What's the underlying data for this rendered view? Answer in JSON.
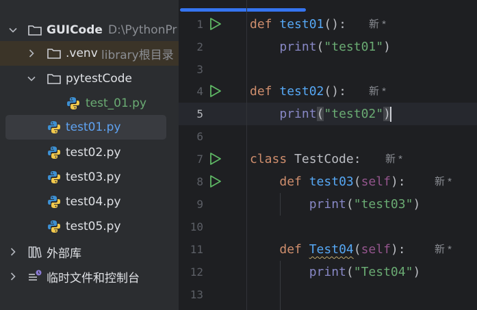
{
  "tree": {
    "root": {
      "label": "GUICode",
      "hint": "D:\\PythonPr"
    },
    "venv": {
      "label": ".venv",
      "hint": "library根目录"
    },
    "pytest_folder": {
      "label": "pytestCode"
    },
    "pytest_file": {
      "label": "test_01.py"
    },
    "files": [
      "test01.py",
      "test02.py",
      "test03.py",
      "test04.py",
      "test05.py"
    ],
    "ext_libs": {
      "label": "外部库"
    },
    "scratches": {
      "label": "临时文件和控制台"
    }
  },
  "editor": {
    "line_numbers": [
      "1",
      "2",
      "3",
      "4",
      "5",
      "6",
      "7",
      "8",
      "9",
      "10",
      "11",
      "12",
      "13"
    ],
    "current_line": "5",
    "badge": "新 *",
    "colors": {
      "keyword": "#cf8e6d",
      "function": "#56a8f5",
      "builtin": "#8888c6",
      "string": "#6aab73",
      "self": "#94558d",
      "run_icon": "#5fb865"
    },
    "lines": {
      "l1": {
        "kw": "def",
        "name": "test01",
        "tail": "():"
      },
      "l2": {
        "fn": "print",
        "open": "(",
        "str": "\"test01\"",
        "close": ")"
      },
      "l4": {
        "kw": "def",
        "name": "test02",
        "tail": "():"
      },
      "l5": {
        "fn": "print",
        "open": "(",
        "str": "\"test02\"",
        "close": ")"
      },
      "l7": {
        "kw": "class",
        "name": "TestCode",
        "tail": ":"
      },
      "l8": {
        "kw": "def",
        "name": "test03",
        "open": "(",
        "self": "self",
        "tail": "):"
      },
      "l9": {
        "fn": "print",
        "open": "(",
        "str": "\"test03\"",
        "close": ")"
      },
      "l11": {
        "kw": "def",
        "name": "Test04",
        "open": "(",
        "self": "self",
        "tail": "):"
      },
      "l12": {
        "fn": "print",
        "open": "(",
        "str": "\"Test04\"",
        "close": ")"
      }
    }
  }
}
